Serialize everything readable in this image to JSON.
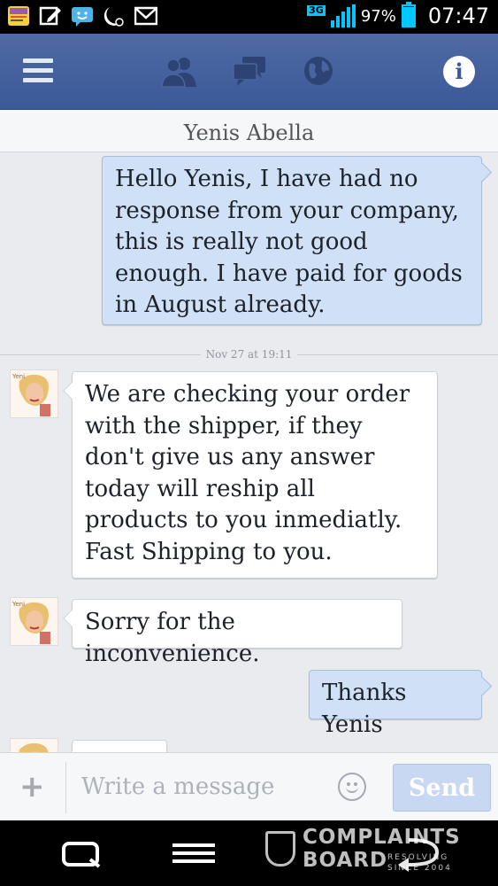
{
  "status_bar": {
    "network": "3G",
    "battery_percent": "97%",
    "battery_level": 0.97,
    "time": "07:47",
    "notification_icons": [
      "news-app-icon",
      "edit-icon",
      "chat-icon",
      "moon-icon",
      "gmail-icon"
    ]
  },
  "header": {
    "icons": [
      "menu-icon",
      "friends-icon",
      "messages-icon",
      "globe-icon",
      "info-icon"
    ],
    "info_label": "i"
  },
  "conversation": {
    "title": "Yenis Abella",
    "timestamp": "Nov 27 at 19:11",
    "messages": [
      {
        "from": "me",
        "text": "Hello Yenis, I have had no response from your company, this is really not good enough. I have paid for goods in August already."
      },
      {
        "from": "Yenis Abella",
        "text": "We are checking your order with the shipper, if they don't give us any answer today will reship all products to you inmediatly. Fast Shipping to you."
      },
      {
        "from": "Yenis Abella",
        "text": "Sorry for the inconvenience."
      },
      {
        "from": "me",
        "text": "Thanks Yenis"
      }
    ]
  },
  "composer": {
    "add_label": "+",
    "placeholder": "Write a message",
    "send_label": "Send"
  },
  "watermark": {
    "line1": "COMPLAINTS",
    "line2": "BOARD",
    "tagline": "RESOLVING SINCE 2004"
  },
  "colors": {
    "fb_blue": "#3b5998",
    "outgoing_bubble": "#cfe0f7",
    "incoming_bubble": "#ffffff",
    "send_disabled": "#c8d7f2"
  }
}
